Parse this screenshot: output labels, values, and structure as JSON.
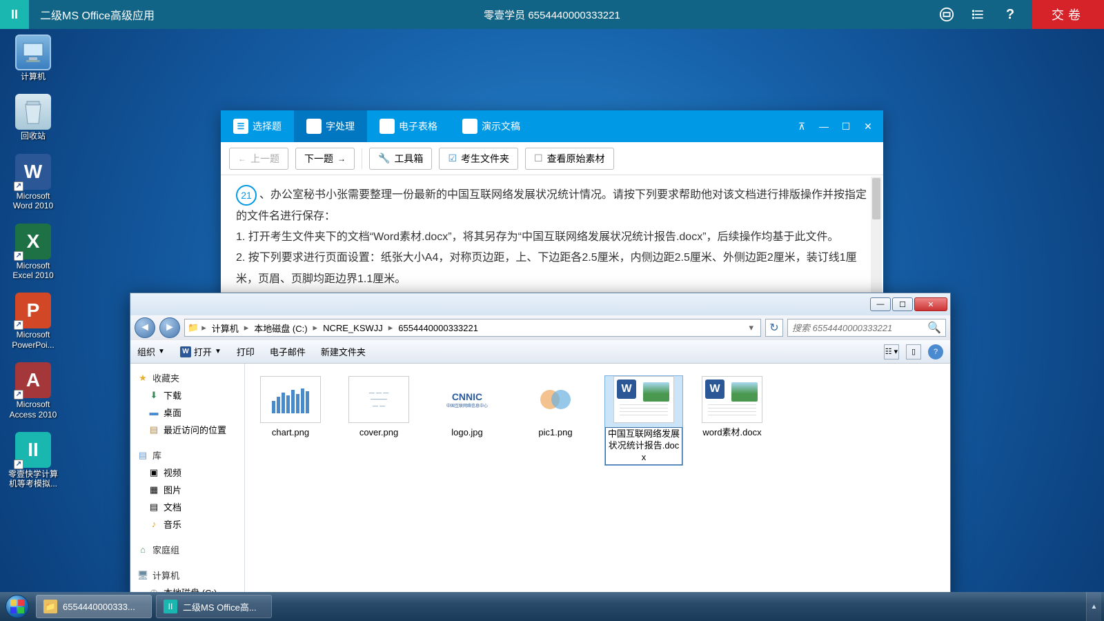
{
  "exam_bar": {
    "app_title": "二级MS Office高级应用",
    "student_info": "零壹学员 6554440000333221",
    "submit_label": "交卷"
  },
  "desktop": {
    "icons": [
      {
        "name": "computer",
        "label": "计算机"
      },
      {
        "name": "recycle",
        "label": "回收站"
      },
      {
        "name": "word",
        "label": "Microsoft Word 2010",
        "glyph": "W"
      },
      {
        "name": "excel",
        "label": "Microsoft Excel 2010",
        "glyph": "X"
      },
      {
        "name": "ppt",
        "label": "Microsoft PowerPoi...",
        "glyph": "P"
      },
      {
        "name": "access",
        "label": "Microsoft Access 2010",
        "glyph": "A"
      },
      {
        "name": "app",
        "label": "零壹快学计算机等考模拟...",
        "glyph": "II"
      }
    ]
  },
  "exam_window": {
    "tabs": [
      {
        "label": "选择题",
        "icon": "doc"
      },
      {
        "label": "字处理",
        "icon": "w"
      },
      {
        "label": "电子表格",
        "icon": "x"
      },
      {
        "label": "演示文稿",
        "icon": "p"
      }
    ],
    "toolbar": {
      "prev": "上一题",
      "next": "下一题",
      "toolbox": "工具箱",
      "files": "考生文件夹",
      "source": "查看原始素材"
    },
    "question_number": "21",
    "question_text": "、办公室秘书小张需要整理一份最新的中国互联网络发展状况统计情况。请按下列要求帮助他对该文档进行排版操作并按指定的文件名进行保存：",
    "step1": "1. 打开考生文件夹下的文档“Word素材.docx”，将其另存为“中国互联网络发展状况统计报告.docx”，后续操作均基于此文件。",
    "step2": "2. 按下列要求进行页面设置：纸张大小A4，对称页边距，上、下边距各2.5厘米，内侧边距2.5厘米、外侧边距2厘米，装订线1厘米，页眉、页脚均距边界1.1厘米。"
  },
  "explorer": {
    "breadcrumb": [
      "计算机",
      "本地磁盘 (C:)",
      "NCRE_KSWJJ",
      "6554440000333221"
    ],
    "search_placeholder": "搜索 6554440000333221",
    "toolbar": {
      "organize": "组织",
      "open": "打开",
      "print": "打印",
      "email": "电子邮件",
      "newfolder": "新建文件夹"
    },
    "sidebar": {
      "favorites": "收藏夹",
      "fav_items": [
        "下载",
        "桌面",
        "最近访问的位置"
      ],
      "library": "库",
      "lib_items": [
        "视频",
        "图片",
        "文档",
        "音乐"
      ],
      "homegroup": "家庭组",
      "computer": "计算机",
      "comp_items": [
        "本地磁盘 (C:)"
      ]
    },
    "files": [
      {
        "name": "chart.png",
        "type": "chart"
      },
      {
        "name": "cover.png",
        "type": "cover"
      },
      {
        "name": "logo.jpg",
        "type": "logo"
      },
      {
        "name": "pic1.png",
        "type": "pic"
      },
      {
        "name": "中国互联网络发展状况统计报告.docx",
        "type": "word",
        "selected": true
      },
      {
        "name": "word素材.docx",
        "type": "word"
      }
    ]
  },
  "taskbar": {
    "items": [
      {
        "label": "6554440000333...",
        "icon": "folder"
      },
      {
        "label": "二级MS Office高...",
        "icon": "app"
      }
    ]
  }
}
